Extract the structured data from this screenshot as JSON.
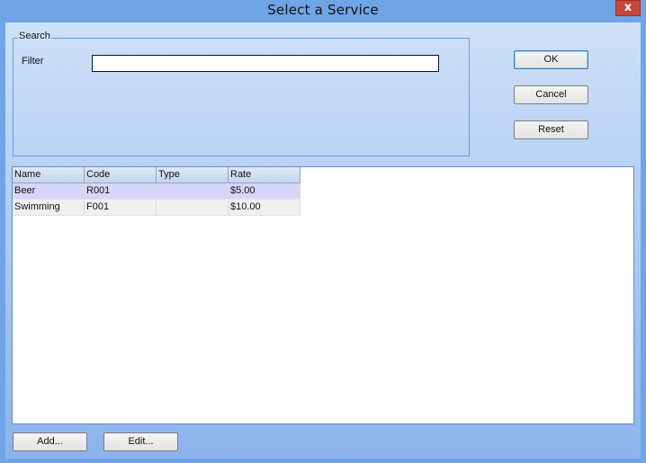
{
  "window": {
    "title": "Select a Service",
    "close_glyph": "x"
  },
  "search": {
    "group_title": "Search",
    "filter_label": "Filter",
    "filter_value": ""
  },
  "buttons": {
    "ok": "OK",
    "cancel": "Cancel",
    "reset": "Reset",
    "add": "Add...",
    "edit": "Edit..."
  },
  "grid": {
    "columns": [
      "Name",
      "Code",
      "Type",
      "Rate"
    ],
    "rows": [
      {
        "name": "Beer",
        "code": "R001",
        "type": "",
        "rate": "$5.00",
        "selected": true
      },
      {
        "name": "Swimming",
        "code": "F001",
        "type": "",
        "rate": "$10.00",
        "selected": false
      }
    ]
  }
}
